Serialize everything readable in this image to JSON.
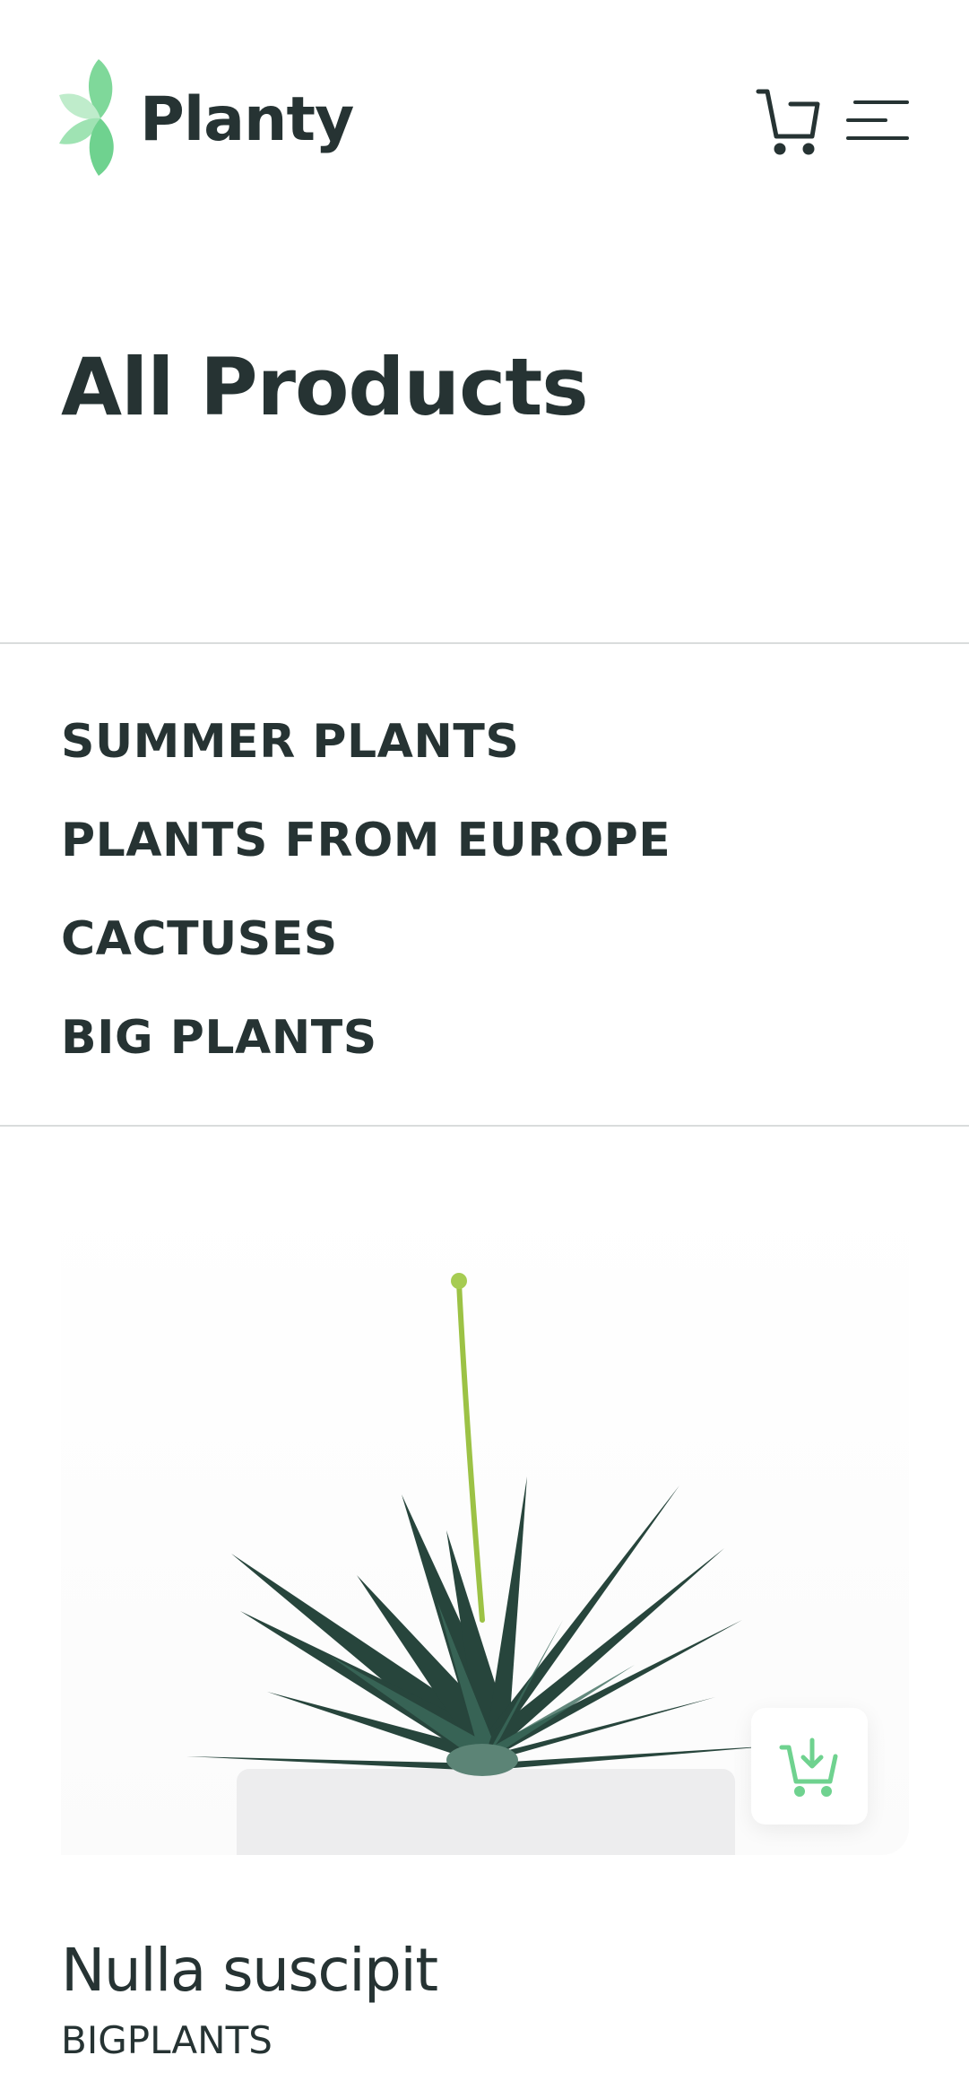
{
  "brand": {
    "name": "Planty",
    "accent_color": "#6fd28f"
  },
  "header": {
    "cart_icon": "cart-icon",
    "menu_icon": "hamburger-menu-icon"
  },
  "page": {
    "title": "All Products"
  },
  "categories": [
    {
      "label": "SUMMER PLANTS"
    },
    {
      "label": "PLANTS FROM EUROPE"
    },
    {
      "label": "CACTUSES"
    },
    {
      "label": "BIG PLANTS"
    }
  ],
  "products": [
    {
      "name": "Nulla suscipit",
      "category": "BIGPLANTS",
      "image": "succulent-plant-in-white-pot",
      "add_to_cart_icon": "add-to-cart-icon"
    }
  ]
}
